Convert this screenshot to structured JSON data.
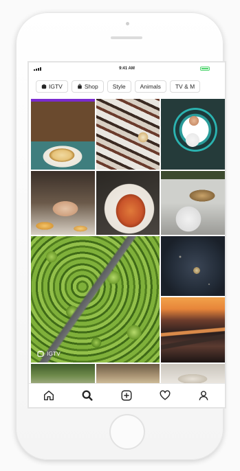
{
  "status_bar": {
    "time": "9:41 AM",
    "battery_color": "#4bd46b"
  },
  "chips": [
    {
      "label": "IGTV",
      "icon": "igtv-icon"
    },
    {
      "label": "Shop",
      "icon": "shopping-bag-icon"
    },
    {
      "label": "Style",
      "icon": null
    },
    {
      "label": "Animals",
      "icon": null
    },
    {
      "label": "TV & M",
      "icon": null
    }
  ],
  "grid": {
    "igtv_label": "IGTV",
    "tiles": [
      "latte-art",
      "cocktails-on-table",
      "man-in-circular-frame",
      "breakfast-plates",
      "pasta-on-fork",
      "food-plating",
      "aerial-forest-road",
      "dark-plate-dish",
      "sunset-lake",
      "greenery",
      "landscape",
      "plated-dish"
    ]
  },
  "tab_bar": {
    "items": [
      "home",
      "search",
      "add",
      "activity",
      "profile"
    ],
    "active": "search"
  }
}
